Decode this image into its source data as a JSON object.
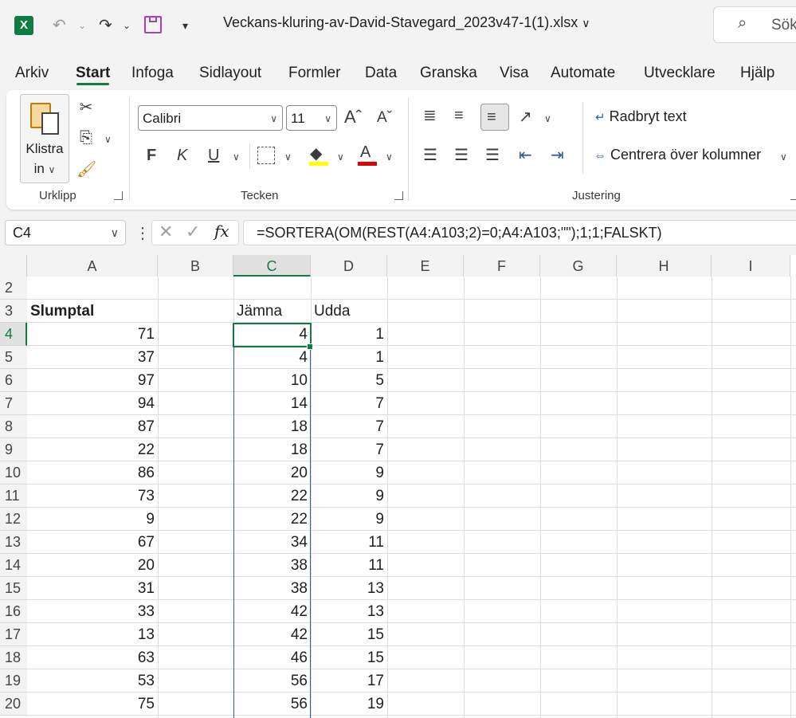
{
  "titlebar": {
    "app_icon": "X",
    "filename": "Veckans-kluring-av-David-Stavegard_2023v47-1(1).xlsx",
    "search_placeholder": "Sök"
  },
  "tabs": [
    "Arkiv",
    "Start",
    "Infoga",
    "Sidlayout",
    "Formler",
    "Data",
    "Granska",
    "Visa",
    "Automate",
    "Utvecklare",
    "Hjälp"
  ],
  "active_tab": "Start",
  "ribbon": {
    "clipboard": {
      "paste_label_line1": "Klistra",
      "paste_label_line2": "in",
      "group_label": "Urklipp"
    },
    "font": {
      "font_name": "Calibri",
      "font_size": "11",
      "bold": "F",
      "italic": "K",
      "underline": "U",
      "group_label": "Tecken"
    },
    "alignment": {
      "wrap_text": "Radbryt text",
      "merge_center": "Centrera över kolumner",
      "group_label": "Justering"
    }
  },
  "formula_bar": {
    "name_box": "C4",
    "fx": "fx",
    "formula": "=SORTERA(OM(REST(A4:A103;2)=0;A4:A103;\"\");1;1;FALSKT)"
  },
  "sheet": {
    "columns": [
      "A",
      "B",
      "C",
      "D",
      "E",
      "F",
      "G",
      "H",
      "I"
    ],
    "selected_column": "C",
    "selected_row": "4",
    "header_row": {
      "row": "3",
      "A": "Slumptal",
      "C": "Jämna",
      "D": "Udda"
    },
    "rows": [
      {
        "row": "2",
        "A": "",
        "C": "",
        "D": ""
      },
      {
        "row": "3",
        "A": "",
        "C": "",
        "D": ""
      },
      {
        "row": "4",
        "A": "71",
        "C": "4",
        "D": "1"
      },
      {
        "row": "5",
        "A": "37",
        "C": "4",
        "D": "1"
      },
      {
        "row": "6",
        "A": "97",
        "C": "10",
        "D": "5"
      },
      {
        "row": "7",
        "A": "94",
        "C": "14",
        "D": "7"
      },
      {
        "row": "8",
        "A": "87",
        "C": "18",
        "D": "7"
      },
      {
        "row": "9",
        "A": "22",
        "C": "18",
        "D": "7"
      },
      {
        "row": "10",
        "A": "86",
        "C": "20",
        "D": "9"
      },
      {
        "row": "11",
        "A": "73",
        "C": "22",
        "D": "9"
      },
      {
        "row": "12",
        "A": "9",
        "C": "22",
        "D": "9"
      },
      {
        "row": "13",
        "A": "67",
        "C": "34",
        "D": "11"
      },
      {
        "row": "14",
        "A": "20",
        "C": "38",
        "D": "11"
      },
      {
        "row": "15",
        "A": "31",
        "C": "38",
        "D": "13"
      },
      {
        "row": "16",
        "A": "33",
        "C": "42",
        "D": "13"
      },
      {
        "row": "17",
        "A": "13",
        "C": "42",
        "D": "15"
      },
      {
        "row": "18",
        "A": "63",
        "C": "46",
        "D": "15"
      },
      {
        "row": "19",
        "A": "53",
        "C": "56",
        "D": "17"
      },
      {
        "row": "20",
        "A": "75",
        "C": "56",
        "D": "19"
      }
    ]
  },
  "colors": {
    "excel_green": "#107c41",
    "selection_blue": "#2f5aa8"
  }
}
